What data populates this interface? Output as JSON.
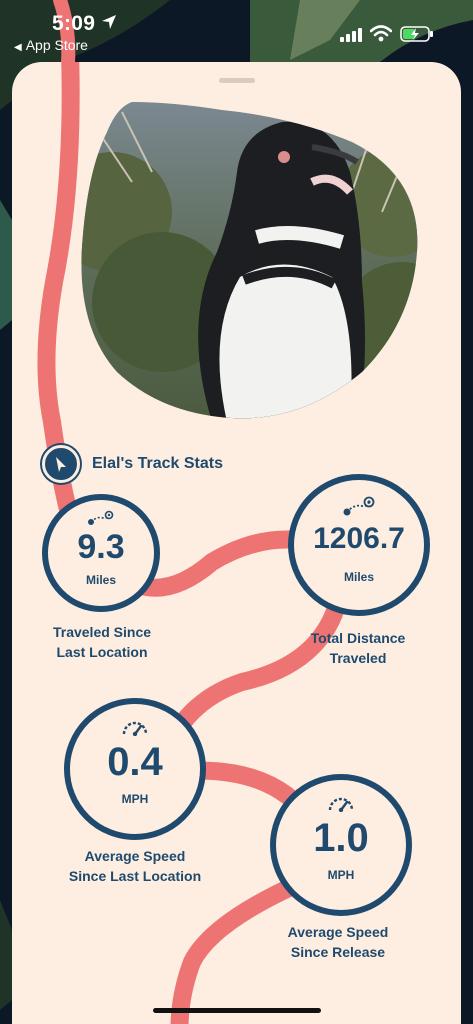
{
  "status_bar": {
    "time": "5:09",
    "back_label": "App Store"
  },
  "header": {
    "title": "Elal's Track Stats"
  },
  "stats": [
    {
      "value": "9.3",
      "unit": "Miles",
      "label_line1": "Traveled Since",
      "label_line2": "Last Location",
      "icon": "route-icon"
    },
    {
      "value": "1206.7",
      "unit": "Miles",
      "label_line1": "Total Distance",
      "label_line2": "Traveled",
      "icon": "route-icon"
    },
    {
      "value": "0.4",
      "unit": "MPH",
      "label_line1": "Average Speed",
      "label_line2": "Since Last Location",
      "icon": "speedometer-icon"
    },
    {
      "value": "1.0",
      "unit": "MPH",
      "label_line1": "Average Speed",
      "label_line2": "Since Release",
      "icon": "speedometer-icon"
    }
  ],
  "colors": {
    "card_bg": "#fdeee1",
    "accent_navy": "#1f4a6e",
    "path_coral": "#ee7474"
  }
}
